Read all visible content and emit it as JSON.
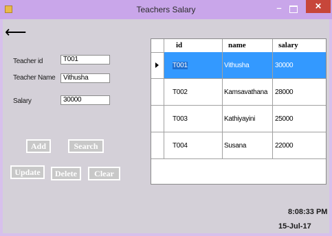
{
  "window": {
    "title": "Teachers Salary",
    "minimize_glyph": "–",
    "close_glyph": "✕",
    "accent_color": "#c9a6ea",
    "close_color": "#c7463a"
  },
  "nav": {
    "back_glyph": "⟵"
  },
  "form": {
    "teacher_id_label": "Teacher id",
    "teacher_id_value": "T001",
    "teacher_name_label": "Teacher Name",
    "teacher_name_value": "Vithusha",
    "salary_label": "Salary",
    "salary_value": "30000"
  },
  "buttons": {
    "add": "Add",
    "search": "Search",
    "update": "Update",
    "delete": "Delete",
    "clear": "Clear"
  },
  "grid": {
    "columns": [
      "id",
      "name",
      "salary"
    ],
    "rows": [
      {
        "id": "T001",
        "name": "Vithusha",
        "salary": "30000",
        "selected": true
      },
      {
        "id": "T002",
        "name": "Kamsavathana",
        "salary": "28000",
        "selected": false
      },
      {
        "id": "T003",
        "name": "Kathiyayini",
        "salary": "25000",
        "selected": false
      },
      {
        "id": "T004",
        "name": "Susana",
        "salary": "22000",
        "selected": false
      }
    ],
    "selection_color": "#3399ff"
  },
  "status": {
    "time": "8:08:33 PM",
    "date": "15-Jul-17"
  }
}
